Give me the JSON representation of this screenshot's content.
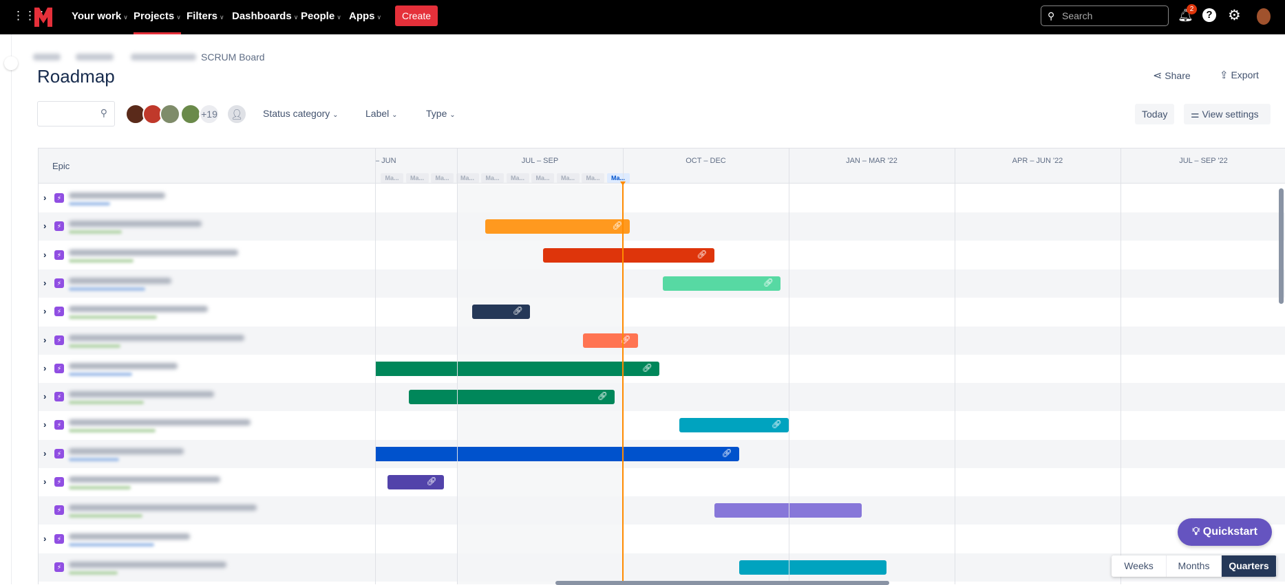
{
  "nav": {
    "items": [
      "Your work",
      "Projects",
      "Filters",
      "Dashboards",
      "People",
      "Apps"
    ],
    "active": "Projects",
    "create": "Create",
    "search_placeholder": "Search",
    "notifications": "2"
  },
  "breadcrumb": {
    "last": "SCRUM Board"
  },
  "page": {
    "title": "Roadmap",
    "share": "Share",
    "export": "Export"
  },
  "toolbar": {
    "more_avatars": "+19",
    "filters": [
      "Status category",
      "Label",
      "Type"
    ],
    "today": "Today",
    "view_settings": "View settings"
  },
  "timeline": {
    "epic_header": "Epic",
    "quarters": [
      "– JUN",
      "JUL – SEP",
      "OCT – DEC",
      "JAN – MAR '22",
      "APR – JUN '22",
      "JUL – SEP '22"
    ],
    "month_pills": [
      "Ma...",
      "Ma...",
      "Ma...",
      "Ma...",
      "Ma...",
      "Ma...",
      "Ma...",
      "Ma...",
      "Ma...",
      "Ma..."
    ],
    "rows": [
      {
        "expand": true,
        "bar": null
      },
      {
        "expand": true,
        "bar": {
          "color": "#FF991F",
          "start": 0.17,
          "end": 1.04,
          "link": true
        }
      },
      {
        "expand": true,
        "bar": {
          "color": "#DE350B",
          "start": 0.52,
          "end": 1.55,
          "link": true
        }
      },
      {
        "expand": true,
        "bar": {
          "color": "#57D9A3",
          "start": 1.24,
          "end": 1.95,
          "link": true
        }
      },
      {
        "expand": true,
        "bar": {
          "color": "#253858",
          "start": 0.09,
          "end": 0.44,
          "link": true
        }
      },
      {
        "expand": true,
        "bar": {
          "color": "#FF7452",
          "start": 0.76,
          "end": 1.09,
          "link": true
        }
      },
      {
        "expand": true,
        "bar": {
          "color": "#00875A",
          "start": -0.5,
          "end": 1.22,
          "link": true
        }
      },
      {
        "expand": true,
        "bar": {
          "color": "#00875A",
          "start": -0.29,
          "end": 0.95,
          "link": true
        }
      },
      {
        "expand": true,
        "bar": {
          "color": "#00A3BF",
          "start": 1.34,
          "end": 2.0,
          "link": true
        }
      },
      {
        "expand": true,
        "bar": {
          "color": "#0052CC",
          "start": -0.5,
          "end": 1.7,
          "link": true
        }
      },
      {
        "expand": true,
        "bar": {
          "color": "#5243AA",
          "start": -0.42,
          "end": -0.08,
          "link": true
        }
      },
      {
        "expand": false,
        "bar": {
          "color": "#8777D9",
          "start": 1.55,
          "end": 2.44,
          "link": false
        }
      },
      {
        "expand": true,
        "bar": null
      },
      {
        "expand": false,
        "bar": {
          "color": "#00A3BF",
          "start": 1.7,
          "end": 2.59,
          "link": false
        }
      }
    ]
  },
  "quickstart": "Quickstart",
  "zoom": {
    "options": [
      "Weeks",
      "Months",
      "Quarters"
    ],
    "selected": "Quarters"
  }
}
